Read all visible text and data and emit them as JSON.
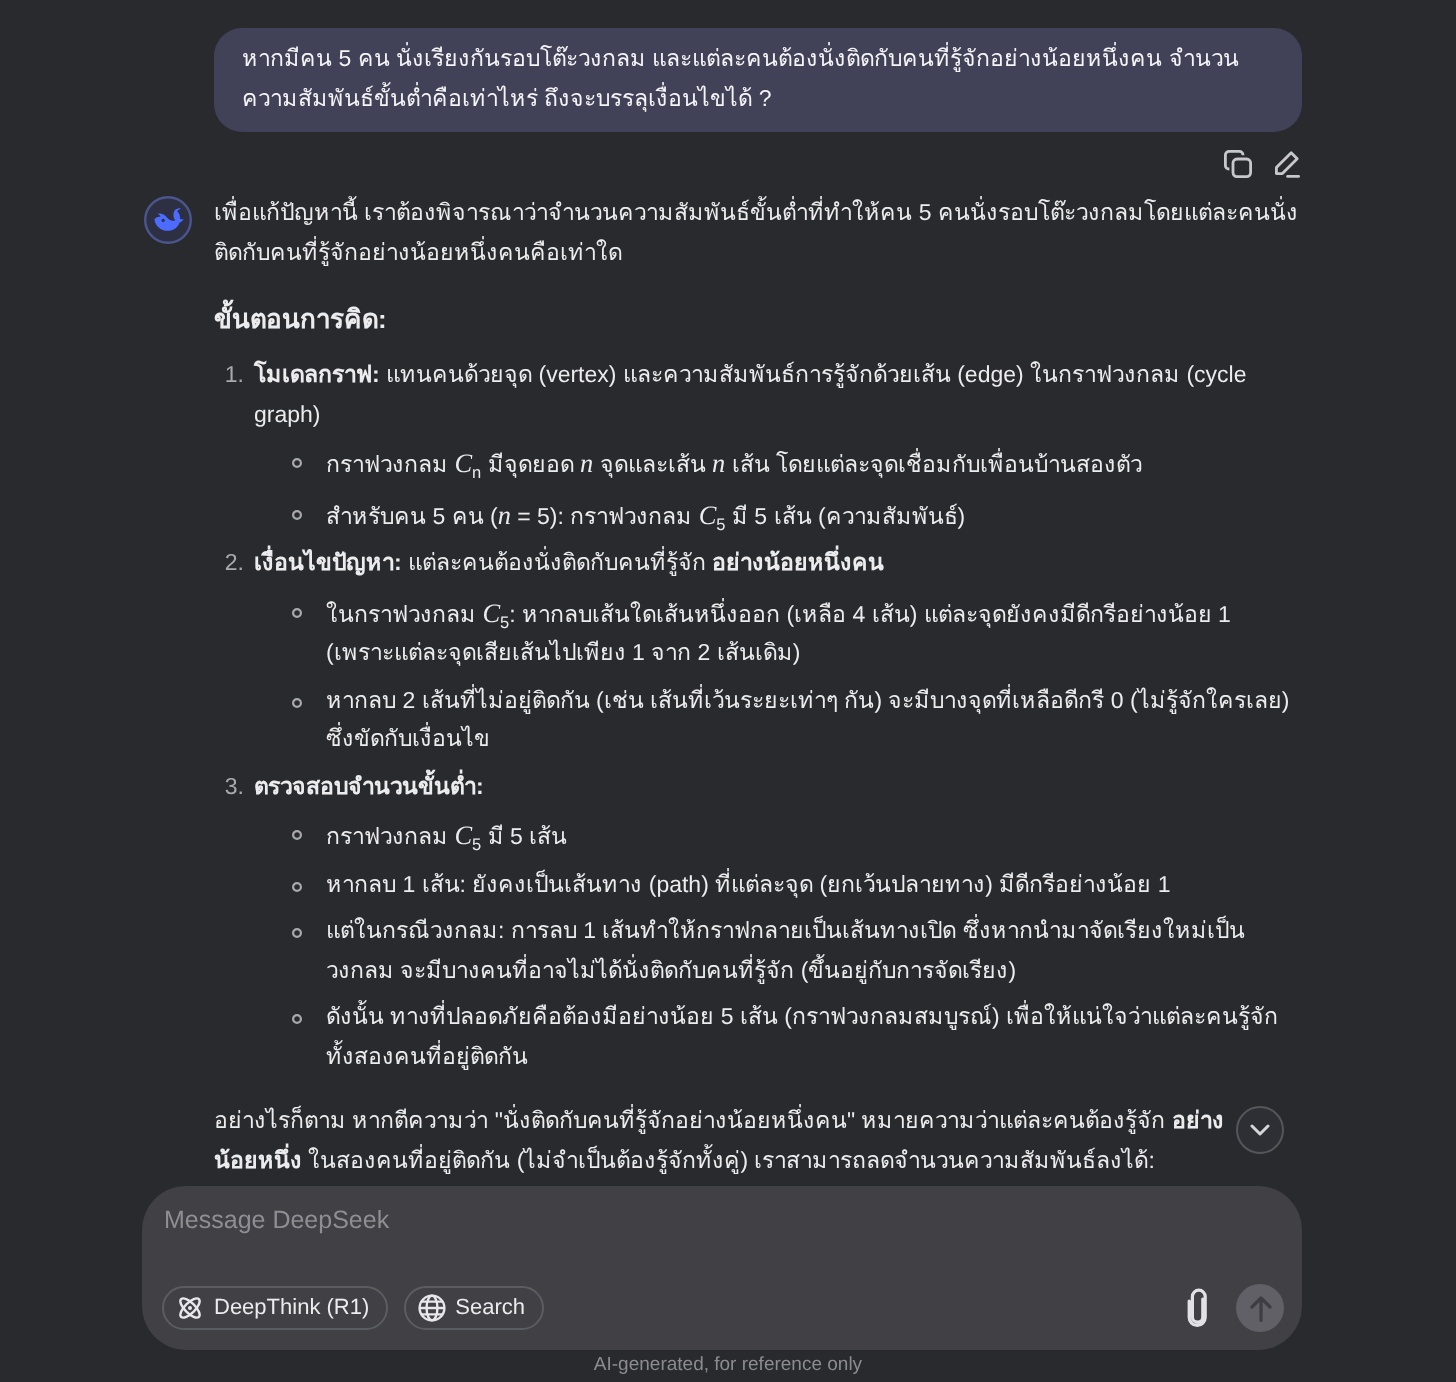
{
  "user_message": {
    "text": "หากมีคน 5 คน นั่งเรียงกันรอบโต๊ะวงกลม และแต่ละคนต้องนั่งติดกับคนที่รู้จักอย่างน้อยหนึ่งคน จำนวนความสัมพันธ์ขั้นต่ำคือเท่าไหร่ ถึงจะบรรลุเงื่อนไขได้ ?"
  },
  "assistant_message": {
    "intro": "เพื่อแก้ปัญหานี้ เราต้องพิจารณาว่าจำนวนความสัมพันธ์ขั้นต่ำที่ทำให้คน 5 คนนั่งรอบโต๊ะวงกลมโดยแต่ละคนนั่งติดกับคนที่รู้จักอย่างน้อยหนึ่งคนคือเท่าใด",
    "heading": "ขั้นตอนการคิด:",
    "steps": [
      {
        "number": "1.",
        "title": "โมเดลกราฟ:",
        "text": "แทนคนด้วยจุด (vertex) และความสัมพันธ์การรู้จักด้วยเส้น (edge) ในกราฟวงกลม (cycle graph)",
        "bullets": [
          "กราฟวงกลม *C*$_{n}$ มีจุดยอด *n* จุดและเส้น *n* เส้น โดยแต่ละจุดเชื่อมกับเพื่อนบ้านสองตัว",
          "สำหรับคน 5 คน (*n* = 5): กราฟวงกลม *C*$_{5}$ มี 5 เส้น (ความสัมพันธ์)"
        ]
      },
      {
        "number": "2.",
        "title": "เงื่อนไขปัญหา:",
        "text": "แต่ละคนต้องนั่งติดกับคนที่รู้จัก **อย่างน้อยหนึ่งคน**",
        "bullets": [
          "ในกราฟวงกลม *C*$_{5}$: หากลบเส้นใดเส้นหนึ่งออก (เหลือ 4 เส้น) แต่ละจุดยังคงมีดีกรีอย่างน้อย 1 (เพราะแต่ละจุดเสียเส้นไปเพียง 1 จาก 2 เส้นเดิม)",
          "หากลบ 2 เส้นที่ไม่อยู่ติดกัน (เช่น เส้นที่เว้นระยะเท่าๆ กัน) จะมีบางจุดที่เหลือดีกรี 0 (ไม่รู้จักใครเลย) ซึ่งขัดกับเงื่อนไข"
        ]
      },
      {
        "number": "3.",
        "title": "ตรวจสอบจำนวนขั้นต่ำ:",
        "bullets": [
          "กราฟวงกลม *C*$_{5}$ มี 5 เส้น",
          "หากลบ 1 เส้น: ยังคงเป็นเส้นทาง (path) ที่แต่ละจุด (ยกเว้นปลายทาง) มีดีกรีอย่างน้อย 1",
          "แต่ในกรณีวงกลม: การลบ 1 เส้นทำให้กราฟกลายเป็นเส้นทางเปิด ซึ่งหากนำมาจัดเรียงใหม่เป็นวงกลม จะมีบางคนที่อาจไม่ได้นั่งติดกับคนที่รู้จัก (ขึ้นอยู่กับการจัดเรียง)",
          "ดังนั้น ทางที่ปลอดภัยคือต้องมีอย่างน้อย 5 เส้น (กราฟวงกลมสมบูรณ์) เพื่อให้แน่ใจว่าแต่ละคนรู้จักทั้งสองคนที่อยู่ติดกัน"
        ]
      }
    ],
    "conclusion": "อย่างไรก็ตาม หากตีความว่า \"นั่งติดกับคนที่รู้จักอย่างน้อยหนึ่งคน\" หมายความว่าแต่ละคนต้องรู้จัก **อย่างน้อยหนึ่ง** ในสองคนที่อยู่ติดกัน (ไม่จำเป็นต้องรู้จักทั้งคู่) เราสามารถลดจำนวนความสัมพันธ์ลงได้:"
  },
  "composer": {
    "placeholder": "Message DeepSeek",
    "toggles": [
      {
        "kind": "deepthink",
        "label": "DeepThink (R1)",
        "selected": false
      },
      {
        "kind": "search",
        "label": "Search",
        "selected": false
      }
    ],
    "send_disabled": true
  },
  "footer": "AI-generated, for reference only"
}
